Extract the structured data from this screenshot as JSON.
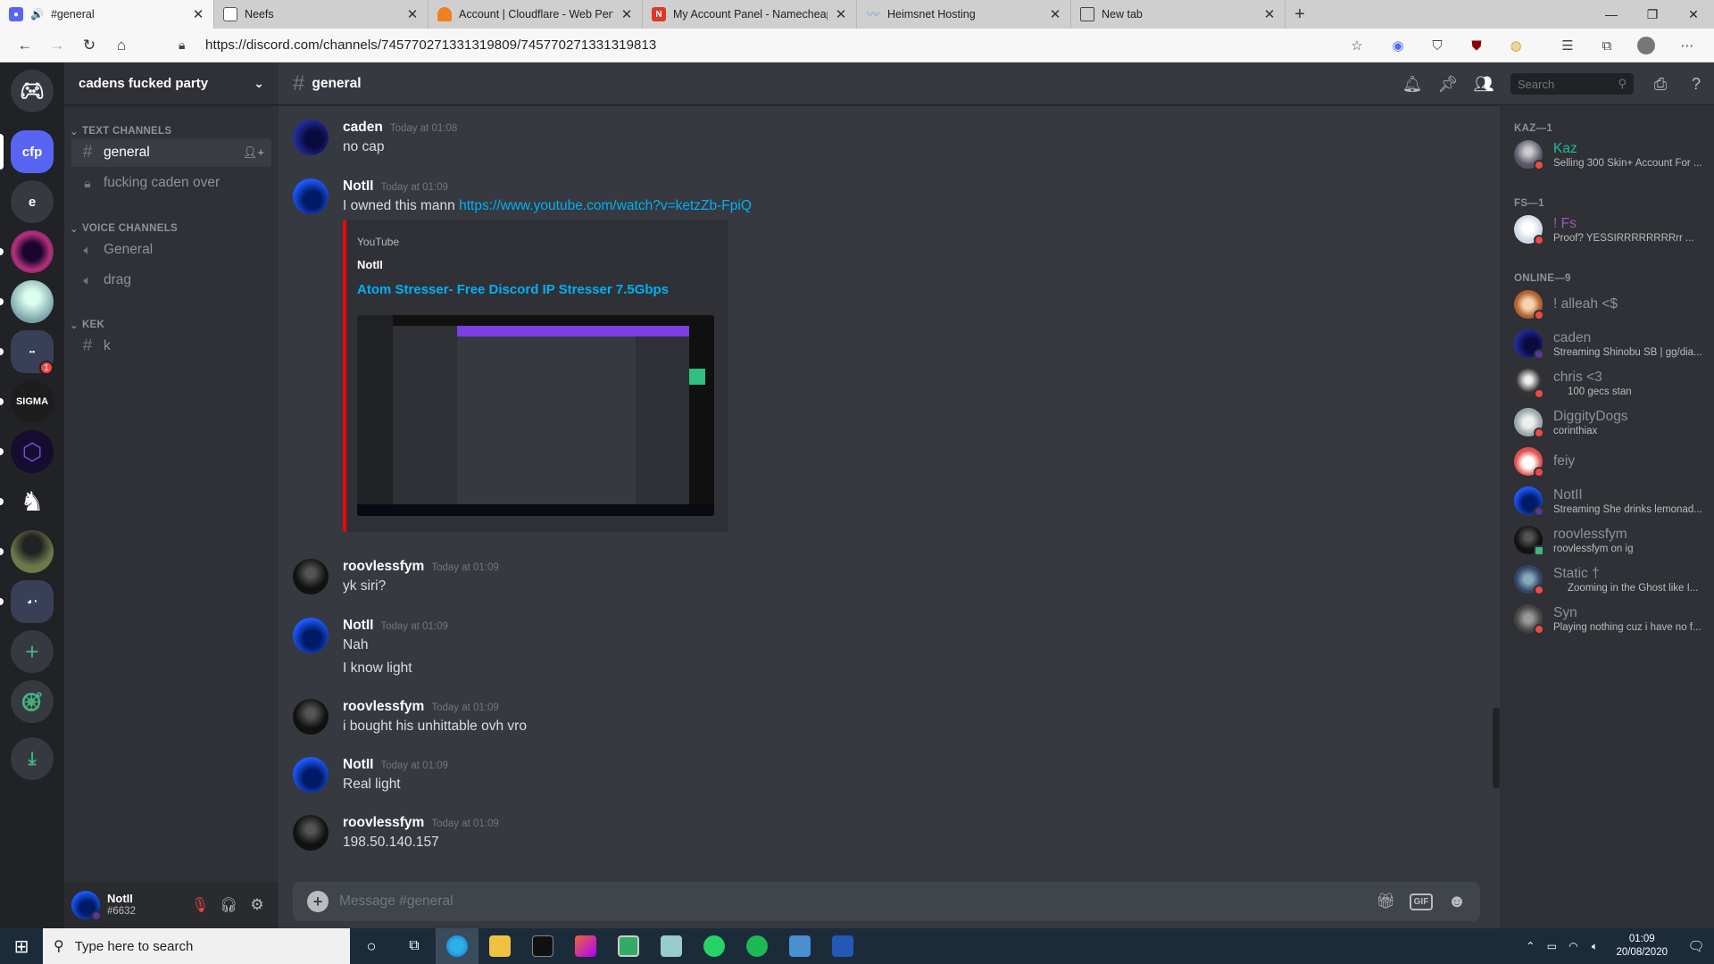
{
  "browser": {
    "tabs": [
      {
        "title": "#general",
        "icon_color": "#5865f2",
        "active": true
      },
      {
        "title": "Neefs",
        "icon_color": "#ffffff",
        "active": false
      },
      {
        "title": "Account | Cloudflare - Web Perfc",
        "icon_color": "#f38020",
        "active": false
      },
      {
        "title": "My Account Panel - Namecheap",
        "icon_color": "#de3723",
        "active": false
      },
      {
        "title": "Heimsnet Hosting",
        "icon_color": "#9db3d6",
        "active": false
      },
      {
        "title": "New tab",
        "icon_color": "#ffffff",
        "active": false
      }
    ],
    "url": "https://discord.com/channels/745770271331319809/745770271331319813"
  },
  "server": {
    "name": "cadens fucked party",
    "categories": {
      "text": "TEXT CHANNELS",
      "voice": "VOICE CHANNELS",
      "kek": "KEK"
    },
    "text_channels": [
      "general",
      "fucking caden over"
    ],
    "voice_channels": [
      "General",
      "drag"
    ],
    "kek_channels": [
      "k"
    ]
  },
  "guilds": [
    {
      "label": "cfp",
      "color": "#5865f2"
    },
    {
      "label": "e",
      "color": "#36393f"
    },
    {
      "label": "",
      "color": "#6b2a8a"
    },
    {
      "label": "",
      "color": "#7aa2a8"
    },
    {
      "label": "",
      "color": "#3a3f58",
      "badge": "1"
    },
    {
      "label": "SIGMA",
      "color": "#1d1d1d"
    },
    {
      "label": "",
      "color": "#2a1a5e"
    },
    {
      "label": "",
      "color": "#202225"
    },
    {
      "label": "",
      "color": "#4a5a3a"
    },
    {
      "label": "",
      "color": "#3a3f58"
    }
  ],
  "user": {
    "name": "NotII",
    "tag": "#6632"
  },
  "channel": {
    "name": "general",
    "search_placeholder": "Search"
  },
  "messages": [
    {
      "author": "caden",
      "time": "Today at 01:08",
      "lines": [
        "no cap"
      ]
    },
    {
      "author": "NotII",
      "time": "Today at 01:09",
      "text": "I owned this mann ",
      "link": "https://www.youtube.com/watch?v=ketzZb-FpiQ",
      "embed": {
        "provider": "YouTube",
        "author": "NotII",
        "title": "Atom Stresser- Free Discord IP Stresser 7.5Gbps"
      }
    },
    {
      "author": "roovlessfym",
      "time": "Today at 01:09",
      "lines": [
        "yk siri?"
      ]
    },
    {
      "author": "NotII",
      "time": "Today at 01:09",
      "lines": [
        "Nah",
        "I know light"
      ]
    },
    {
      "author": "roovlessfym",
      "time": "Today at 01:09",
      "lines": [
        "i bought his unhittable ovh vro"
      ]
    },
    {
      "author": "NotII",
      "time": "Today at 01:09",
      "lines": [
        "Real light"
      ]
    },
    {
      "author": "roovlessfym",
      "time": "Today at 01:09",
      "lines": [
        "198.50.140.157"
      ]
    }
  ],
  "composer": {
    "placeholder": "Message #general",
    "gif": "GIF"
  },
  "members": {
    "groups": [
      {
        "title": "KAZ—1",
        "members": [
          {
            "name": "Kaz",
            "color": "#1abc9c",
            "activity": "Selling 300 Skin+ Account For ...",
            "status": "#f04747"
          }
        ]
      },
      {
        "title": "FS—1",
        "members": [
          {
            "name": "! Fs",
            "color": "#9b59b6",
            "activity": "Proof? YESSIRRRRRRRRrr ...",
            "status": "#f04747"
          }
        ]
      },
      {
        "title": "ONLINE—9",
        "members": [
          {
            "name": "! alleah <$",
            "color": "#8e9297",
            "activity": "",
            "status": "#f04747"
          },
          {
            "name": "caden",
            "color": "#8e9297",
            "activity": "Streaming Shinobu SB | gg/dia...",
            "status": "#593695"
          },
          {
            "name": "chris <3",
            "color": "#8e9297",
            "activity": "100 gecs stan",
            "status": "#f04747"
          },
          {
            "name": "DiggityDogs",
            "color": "#8e9297",
            "activity": "corinthiax",
            "status": "#f04747"
          },
          {
            "name": "feiy",
            "color": "#8e9297",
            "activity": "",
            "status": "#f04747"
          },
          {
            "name": "NotII",
            "color": "#8e9297",
            "activity": "Streaming She drinks lemonad...",
            "status": "#593695"
          },
          {
            "name": "roovlessfym",
            "color": "#8e9297",
            "activity": "roovlessfym on ig",
            "status": "#43b581"
          },
          {
            "name": "Static †",
            "color": "#8e9297",
            "activity": "Zooming in the Ghost like I...",
            "status": "#f04747"
          },
          {
            "name": "Syn",
            "color": "#8e9297",
            "activity": "Playing nothing cuz i have no f...",
            "status": "#f04747"
          }
        ]
      }
    ]
  },
  "taskbar": {
    "search_placeholder": "Type here to search",
    "time": "01:09",
    "date": "20/08/2020"
  }
}
